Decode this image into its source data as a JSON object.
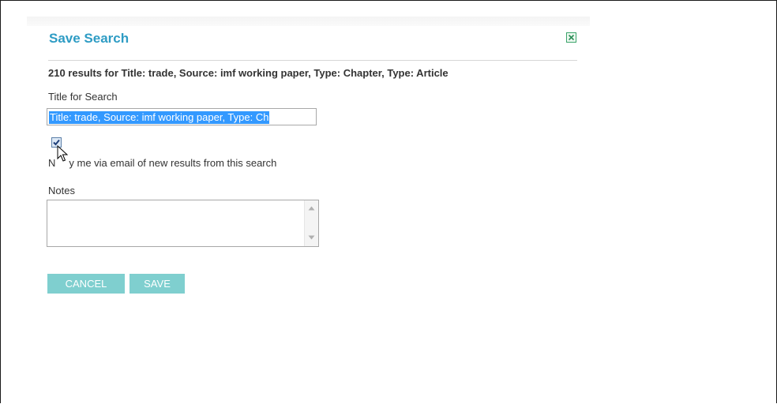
{
  "dialog": {
    "title": "Save Search",
    "close_icon": "close-icon"
  },
  "summary": "210 results for Title: trade, Source: imf working paper, Type: Chapter, Type: Article",
  "title_field": {
    "label": "Title for Search",
    "value": "Title: trade, Source: imf working paper, Type: Ch",
    "selected": true
  },
  "notify": {
    "checked": true,
    "label": "Notify me via email of new results from this search",
    "visible_label_prefix": "N",
    "visible_label_suffix": "y me via email of new results from this search"
  },
  "notes": {
    "label": "Notes",
    "value": ""
  },
  "buttons": {
    "cancel": "CANCEL",
    "save": "SAVE"
  },
  "colors": {
    "title": "#2e9cc4",
    "button_bg": "#7fcfcf",
    "selection": "#3399ff",
    "close_icon": "#3aa36a"
  }
}
